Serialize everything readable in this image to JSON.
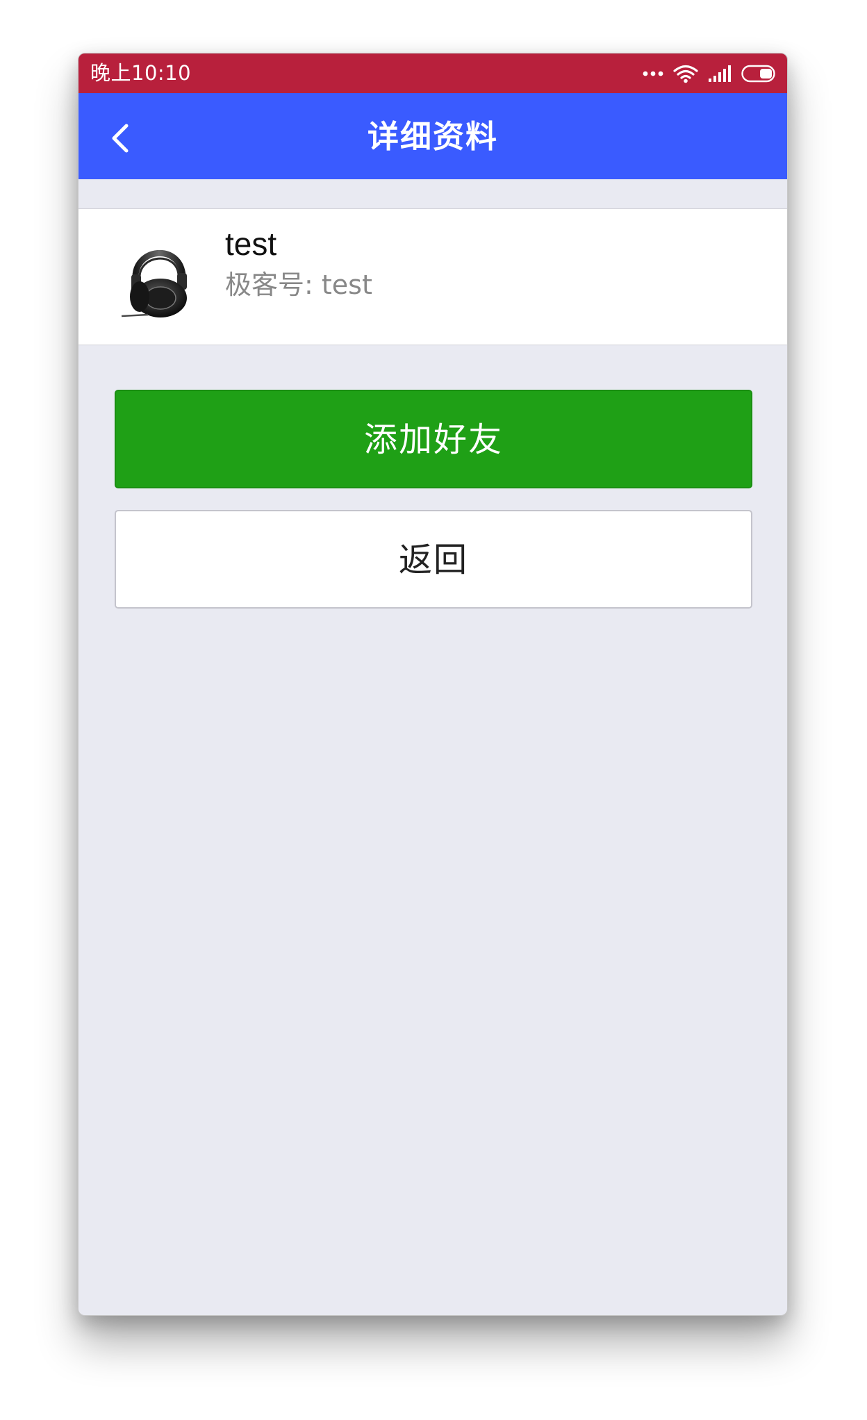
{
  "status_bar": {
    "time": "晚上10:10",
    "icons": [
      "more-dots-icon",
      "wifi-icon",
      "signal-icon",
      "battery-icon"
    ]
  },
  "nav": {
    "title": "详细资料",
    "back_icon": "chevron-left-icon"
  },
  "profile": {
    "name": "test",
    "id_text": "极客号: test",
    "avatar_icon": "headphones-icon"
  },
  "actions": {
    "add_friend_label": "添加好友",
    "back_label": "返回"
  },
  "colors": {
    "status_bar": "#b8203c",
    "nav_bar": "#3a5bff",
    "primary_button": "#1fa016",
    "background": "#e9eaf2"
  }
}
